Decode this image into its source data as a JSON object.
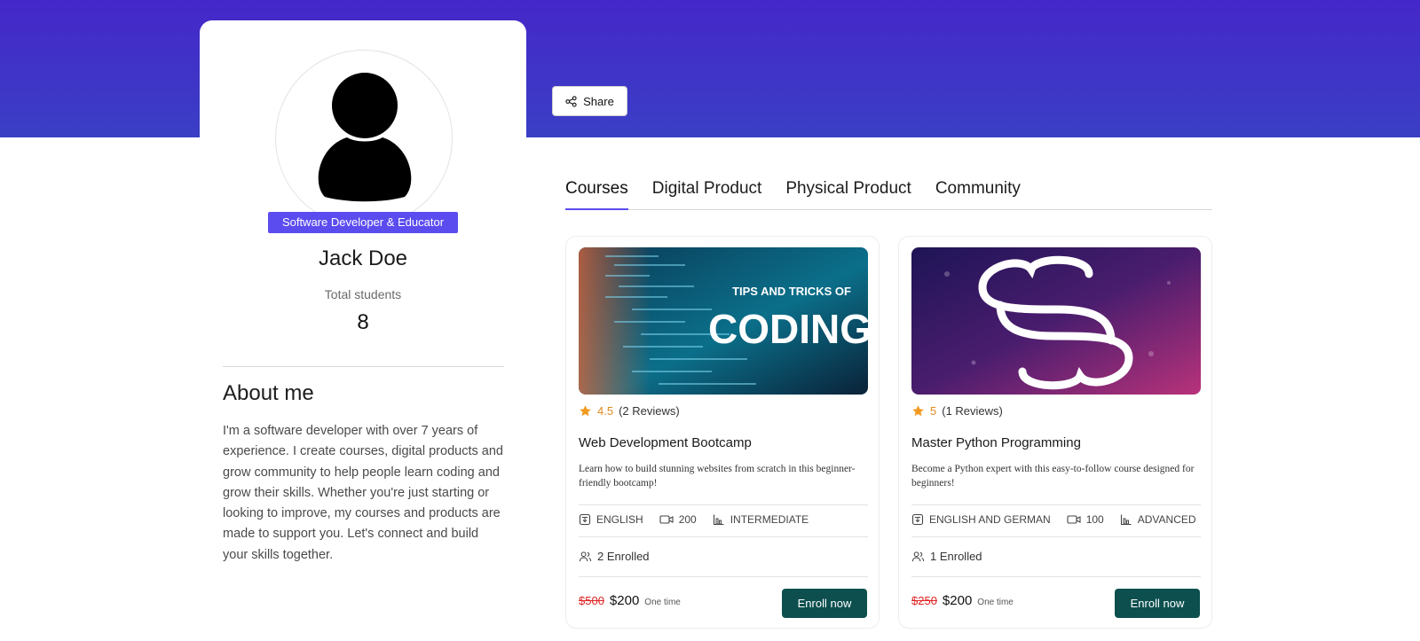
{
  "profile": {
    "role_badge": "Software Developer & Educator",
    "name": "Jack Doe",
    "stat_label": "Total students",
    "stat_value": "8",
    "about_title": "About me",
    "about_text": "I'm a software developer with over 7 years of experience. I create courses, digital products and grow community to help people learn coding and grow their skills. Whether you're just starting or looking to improve, my courses and products are made to support you. Let's connect and build your skills together."
  },
  "share": {
    "label": "Share",
    "icon": "share-icon"
  },
  "tabs": [
    {
      "label": "Courses",
      "active": true
    },
    {
      "label": "Digital Product",
      "active": false
    },
    {
      "label": "Physical Product",
      "active": false
    },
    {
      "label": "Community",
      "active": false
    }
  ],
  "courses": [
    {
      "thumb_caption_small": "TIPS AND TRICKS OF",
      "thumb_caption_big": "CODING",
      "rating": "4.5",
      "reviews": "(2 Reviews)",
      "title": "Web Development Bootcamp",
      "description": "Learn how to build stunning websites from scratch in this beginner-friendly bootcamp!",
      "language": "ENGLISH",
      "videos": "200",
      "level": "INTERMEDIATE",
      "enrolled": "2 Enrolled",
      "old_price": "$500",
      "price": "$200",
      "price_type": "One time",
      "button": "Enroll now"
    },
    {
      "rating": "5",
      "reviews": "(1 Reviews)",
      "title": "Master Python Programming",
      "description": "Become a Python expert with this easy-to-follow course designed for beginners!",
      "language": "ENGLISH AND GERMAN",
      "videos": "100",
      "level": "ADVANCED",
      "enrolled": "1 Enrolled",
      "old_price": "$250",
      "price": "$200",
      "price_type": "One time",
      "button": "Enroll now"
    }
  ],
  "colors": {
    "banner": "#4527c9",
    "accent": "#5b4cf0",
    "enroll_button": "#0d4f4f",
    "rating": "#e08a1e",
    "old_price": "#e02424"
  }
}
